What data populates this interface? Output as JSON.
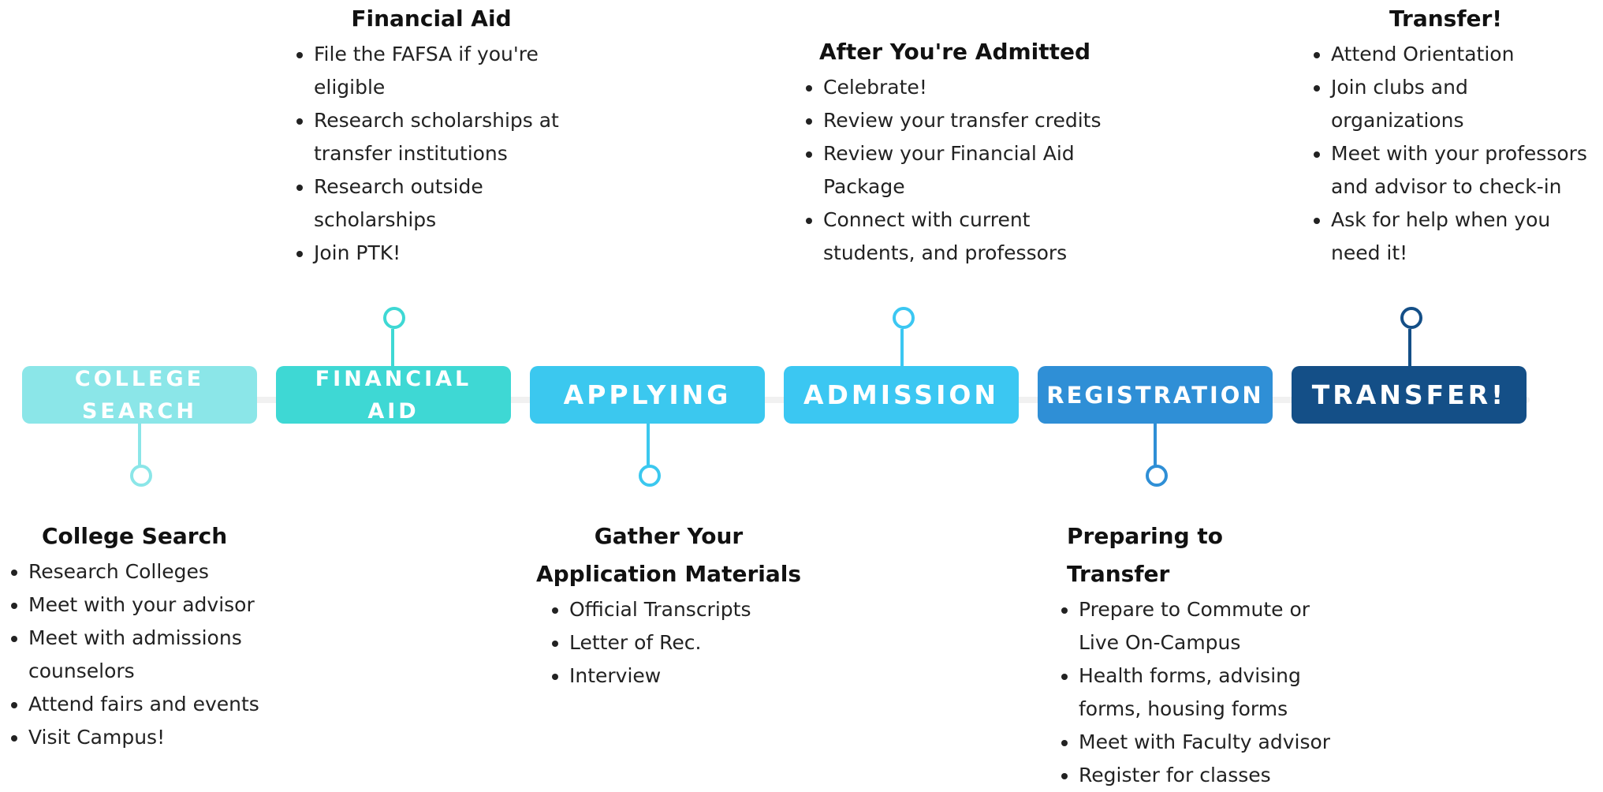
{
  "colors": {
    "college_search": "#8be6e8",
    "financial_aid": "#3ed8d4",
    "applying": "#3bc8ef",
    "admission": "#3bc7f2",
    "registration": "#2f8fd6",
    "transfer": "#144f87"
  },
  "stages": [
    {
      "lines": [
        "COLLEGE",
        "SEARCH"
      ]
    },
    {
      "lines": [
        "FINANCIAL",
        "AID"
      ]
    },
    {
      "label": "APPLYING"
    },
    {
      "label": "ADMISSION"
    },
    {
      "label": "REGISTRATION"
    },
    {
      "label": "TRANSFER!"
    }
  ],
  "blocks": {
    "financial_aid": {
      "title": "Financial Aid",
      "items": [
        "File the FAFSA if you're eligible",
        "Research scholarships at transfer institutions",
        "Research outside scholarships",
        "Join PTK!"
      ]
    },
    "after_admitted": {
      "title": "After You're Admitted",
      "items": [
        "Celebrate!",
        "Review your transfer credits",
        "Review your Financial Aid Package",
        "Connect with current students, and professors"
      ]
    },
    "transfer": {
      "title": "Transfer!",
      "items": [
        "Attend Orientation",
        "Join clubs and organizations",
        "Meet with your professors and advisor to check-in",
        "Ask for help when you need it!"
      ]
    },
    "college_search": {
      "title": "College Search",
      "items": [
        "Research Colleges",
        "Meet with your advisor",
        "Meet with admissions counselors",
        "Attend fairs and events",
        "Visit Campus!"
      ]
    },
    "gather_materials": {
      "title_lines": [
        "Gather Your",
        "Application Materials"
      ],
      "items": [
        "Official Transcripts",
        "Letter of Rec.",
        "Interview"
      ]
    },
    "preparing": {
      "title": "Preparing to Transfer",
      "items": [
        "Prepare to Commute or Live On-Campus",
        "Health forms, advising forms, housing forms",
        "Meet with  Faculty advisor",
        "Register for classes"
      ]
    }
  }
}
